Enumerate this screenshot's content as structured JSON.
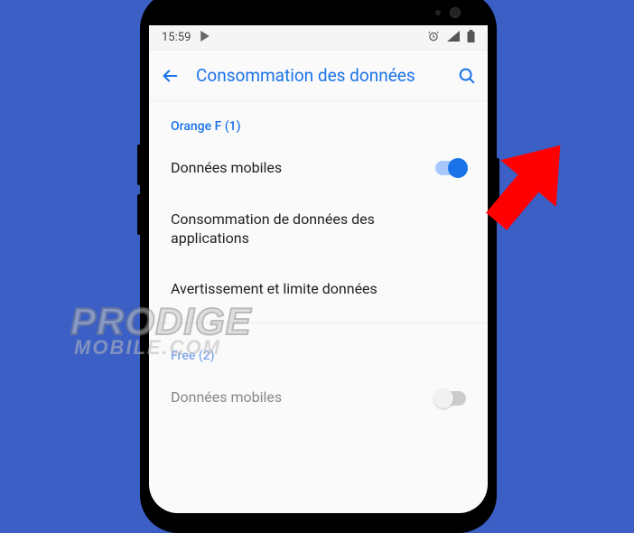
{
  "status": {
    "time": "15:59",
    "play_icon": "play-store-icon",
    "alarm_icon": "alarm-icon",
    "signal_icon": "signal-icon",
    "battery_icon": "battery-icon"
  },
  "appbar": {
    "back": "←",
    "title": "Consommation des données",
    "search": "search"
  },
  "sections": [
    {
      "header": "Orange F (1)",
      "items": [
        {
          "label": "Données mobiles",
          "switch": "on"
        },
        {
          "label": "Consommation de données des applications"
        },
        {
          "label": "Avertissement et limite données"
        }
      ]
    },
    {
      "header": "Free (2)",
      "faded": true,
      "items": [
        {
          "label": "Données mobiles",
          "switch": "off",
          "faded": true
        }
      ]
    }
  ],
  "watermark": {
    "line1": "PRODIGE",
    "line2": "MOBILE.COM"
  }
}
